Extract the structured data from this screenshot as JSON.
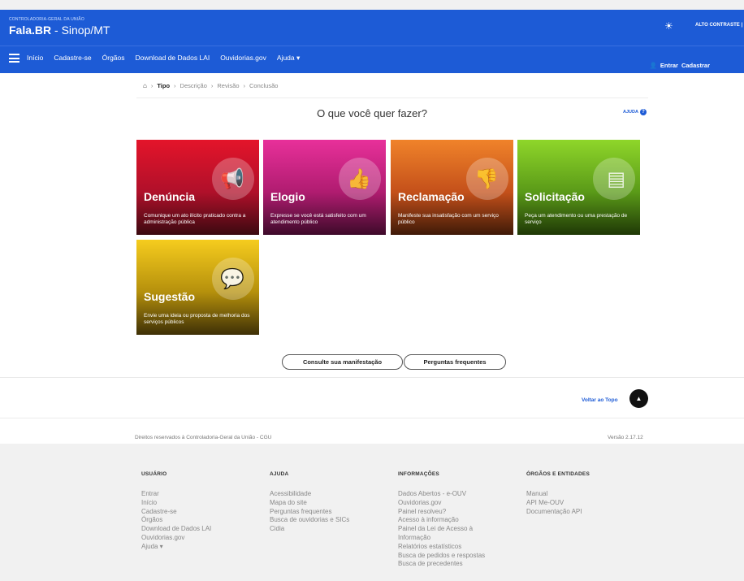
{
  "header": {
    "org": "CONTROLADORIA-GERAL DA UNIÃO",
    "title_main": "Fala.BR",
    "title_rest": " - Sinop/MT",
    "contrast_label": "ALTO CONTRASTE |",
    "icons": {
      "contrast": "sun-icon",
      "menu": "menu-icon",
      "user": "user-icon"
    }
  },
  "nav": {
    "items": [
      "Início",
      "Cadastre-se",
      "Órgãos",
      "Download de Dados LAI",
      "Ouvidorias.gov",
      "Ajuda ▾"
    ],
    "login": "Entrar",
    "register": "Cadastrar"
  },
  "breadcrumb": {
    "home_icon": "home-icon",
    "steps": [
      "Tipo",
      "Descrição",
      "Revisão",
      "Conclusão"
    ],
    "separator": "›"
  },
  "main": {
    "heading": "O que você quer fazer?",
    "help": "AJUDA"
  },
  "cards": [
    {
      "title": "Denúncia",
      "text": "Comunique um ato ilícito praticado contra a administração pública",
      "icon": "megaphone-icon",
      "color": "#e4142a"
    },
    {
      "title": "Elogio",
      "text": "Expresse se você está satisfeito com um atendimento público",
      "icon": "thumbs-up-icon",
      "color": "#e8309a"
    },
    {
      "title": "Reclamação",
      "text": "Manifeste sua insatisfação com um serviço público",
      "icon": "thumbs-down-icon",
      "color": "#f0832a"
    },
    {
      "title": "Solicitação",
      "text": "Peça um atendimento ou uma prestação de serviço",
      "icon": "form-icon",
      "color": "#8fd62a"
    },
    {
      "title": "Sugestão",
      "text": "Envie uma ideia ou proposta de melhoria dos serviços públicos",
      "icon": "speech-bubble-icon",
      "color": "#f6cc1e"
    }
  ],
  "buttons": {
    "consult": "Consulte sua manifestação",
    "faq": "Perguntas frequentes"
  },
  "back_to_top": "Voltar ao Topo",
  "rights": "Direitos reservados à Controladoria-Geral da União - CGU",
  "version": "Versão 2.17.12",
  "footer": {
    "columns": [
      {
        "title": "USUÁRIO",
        "links": [
          "Entrar",
          "Início",
          "Cadastre-se",
          "Órgãos",
          "Download de Dados LAI",
          "Ouvidorias.gov",
          "Ajuda ▾"
        ]
      },
      {
        "title": "AJUDA",
        "links": [
          "Acessibilidade",
          "Mapa do site",
          "Perguntas frequentes",
          "Busca de ouvidorias e SICs",
          "Cidia"
        ]
      },
      {
        "title": "INFORMAÇÕES",
        "links": [
          "Dados Abertos - e-OUV",
          "Ouvidorias.gov",
          "Painel resolveu?",
          "Acesso à informação",
          "Painel da Lei de Acesso à Informação",
          "Relatórios estatísticos",
          "Busca de pedidos e respostas",
          "Busca de precedentes"
        ]
      },
      {
        "title": "ÓRGÃOS E ENTIDADES",
        "links": [
          "Manual",
          "API Me-OUV",
          "Documentação API"
        ]
      }
    ]
  }
}
